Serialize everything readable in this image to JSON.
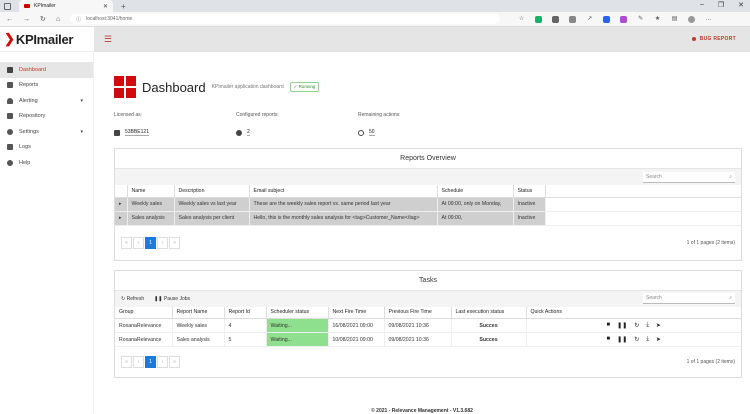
{
  "browser": {
    "tab_title": "KPImailer",
    "url": "localhost:3041/home"
  },
  "brand": {
    "logo_text": "KPImailer",
    "accent": "#d10b0b"
  },
  "header": {
    "bug_report": "BUG REPORT"
  },
  "sidebar": {
    "items": [
      {
        "label": "Dashboard",
        "icon": "grid-icon",
        "active": true
      },
      {
        "label": "Reports",
        "icon": "chart-icon"
      },
      {
        "label": "Alerting",
        "icon": "bell-icon",
        "arrow": "▾"
      },
      {
        "label": "Repository",
        "icon": "folder-icon"
      },
      {
        "label": "Settings",
        "icon": "gear-icon",
        "arrow": "▾"
      },
      {
        "label": "Logs",
        "icon": "document-icon"
      },
      {
        "label": "Help",
        "icon": "help-icon"
      }
    ]
  },
  "dashboard": {
    "title": "Dashboard",
    "subtitle": "KPImailer application dashboard",
    "status": "Running",
    "licensed_label": "Licensed as:",
    "licensed_value": "53BBE121",
    "configured_label": "Configured reports:",
    "configured_value": "2",
    "remaining_label": "Remaining actions:",
    "remaining_value": "50"
  },
  "reports": {
    "title": "Reports Overview",
    "search_placeholder": "Search",
    "columns": [
      "",
      "Name",
      "Description",
      "Email subject",
      "Schedule",
      "Status"
    ],
    "rows": [
      [
        "▸",
        "Weekly sales",
        "Weekly sales vs last year",
        "These are the weekly sales report vs. same period last year",
        "At 09:00, only on Monday,",
        "Inactive"
      ],
      [
        "▸",
        "Sales analysis",
        "Sales analysis per client",
        "Hello, this is the monthly sales analysis for <tag>Customer_Name</tag>",
        "At 09:00,",
        "Inactive"
      ]
    ],
    "pager": {
      "first": "«",
      "prev": "‹",
      "current": "1",
      "next": "›",
      "last": "»",
      "info": "1 of 1 pages (2 items)"
    }
  },
  "tasks": {
    "title": "Tasks",
    "refresh": "Refresh",
    "pause": "Pause Jobs",
    "search_placeholder": "Search",
    "columns": [
      "Group",
      "Report Name",
      "Report Id",
      "Scheduler status",
      "Next Fire Time",
      "Previous Fire Time",
      "Last execution status",
      "Quick Actions"
    ],
    "rows": [
      [
        "RoxanaRelevance",
        "Weekly sales",
        "4",
        "Waiting...",
        "16/08/2021 09:00",
        "09/08/2021 10:36",
        "Succes"
      ],
      [
        "RoxanaRelevance",
        "Sales analysis",
        "5",
        "Waiting...",
        "10/08/2021 09:00",
        "09/08/2021 10:36",
        "Succes"
      ]
    ],
    "pager": {
      "first": "«",
      "prev": "‹",
      "current": "1",
      "next": "›",
      "last": "»",
      "info": "1 of 1 pages (2 items)"
    }
  },
  "footer": "© 2021 - Relevance Management - V1.3.682"
}
